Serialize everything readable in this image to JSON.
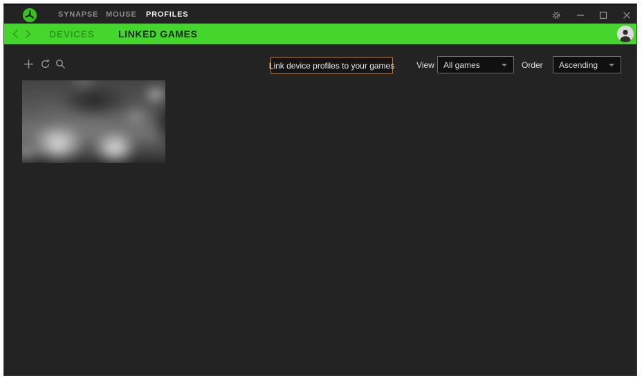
{
  "titlebar": {
    "tabs": [
      {
        "label": "SYNAPSE",
        "active": false
      },
      {
        "label": "MOUSE",
        "active": false
      },
      {
        "label": "PROFILES",
        "active": true
      }
    ]
  },
  "navbar": {
    "tabs": [
      {
        "label": "DEVICES",
        "active": false
      },
      {
        "label": "LINKED GAMES",
        "active": true
      }
    ]
  },
  "toolbar": {
    "icons": [
      "add-icon",
      "refresh-icon",
      "search-icon"
    ],
    "link_button_label": "Link device profiles to your games",
    "view_label": "View",
    "view_value": "All games",
    "order_label": "Order",
    "order_value": "Ascending"
  },
  "content": {
    "tiles": [
      {
        "name": "blurred game thumbnail"
      }
    ]
  },
  "colors": {
    "razer_green": "#44d62c",
    "accent_orange": "#d9731d",
    "window_bg": "#232323",
    "icon_grey": "#9a9a9a"
  }
}
